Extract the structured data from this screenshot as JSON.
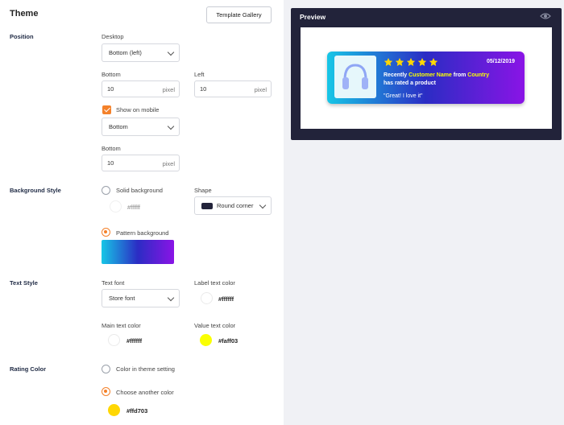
{
  "header": {
    "title": "Theme",
    "template_gallery_label": "Template Gallery"
  },
  "position": {
    "section_label": "Position",
    "desktop_label": "Desktop",
    "desktop_value": "Bottom (left)",
    "bottom_label": "Bottom",
    "bottom_value": "10",
    "left_label": "Left",
    "left_value": "10",
    "unit": "pixel",
    "show_on_mobile_label": "Show on mobile",
    "show_on_mobile_checked": true,
    "mobile_value": "Bottom",
    "mobile_bottom_label": "Bottom",
    "mobile_bottom_value": "10"
  },
  "background": {
    "section_label": "Background Style",
    "solid_label": "Solid background",
    "solid_hex": "#ffffff",
    "shape_label": "Shape",
    "shape_value": "Round corner",
    "pattern_label": "Pattern background",
    "selected": "pattern",
    "gradient_colors": [
      "#17c6e6",
      "#2b2cc4",
      "#8a14e6"
    ]
  },
  "text_style": {
    "section_label": "Text Style",
    "text_font_label": "Text font",
    "text_font_value": "Store font",
    "label_color_label": "Label text color",
    "label_color_hex": "#ffffff",
    "main_color_label": "Main text color",
    "main_color_hex": "#ffffff",
    "value_color_label": "Value text color",
    "value_color_hex": "#faff03"
  },
  "rating": {
    "section_label": "Rating Color",
    "theme_option_label": "Color in theme setting",
    "other_option_label": "Choose another color",
    "selected": "other",
    "color_hex": "#ffd703"
  },
  "preview": {
    "title": "Preview",
    "notification": {
      "date": "05/12/2019",
      "rating_stars": 5,
      "line1_prefix": "Recently",
      "customer_name": "Customer Name",
      "line1_mid": "from",
      "country": "Country",
      "line2": "has rated a product",
      "quote": "\"Great! I love it\""
    }
  },
  "icons": {
    "eye": "eye-icon",
    "check": "check-icon",
    "chevron": "chevron-down-icon",
    "star": "star-icon",
    "headphones": "headphones-icon"
  },
  "colors": {
    "accent": "#f4812a",
    "preview_bg": "#22233a",
    "highlight": "#faff03",
    "star": "#ffd703"
  }
}
